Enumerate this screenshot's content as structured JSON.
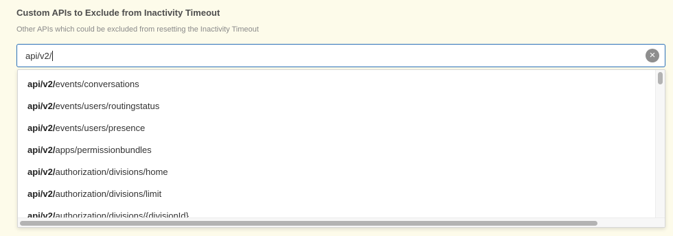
{
  "field": {
    "title": "Custom APIs to Exclude from Inactivity Timeout",
    "description": "Other APIs which could be excluded from resetting the Inactivity Timeout",
    "value": "api/v2/",
    "clear_glyph": "×"
  },
  "suggestions": [
    {
      "match": "api/v2/",
      "rest": "events/conversations"
    },
    {
      "match": "api/v2/",
      "rest": "events/users/routingstatus"
    },
    {
      "match": "api/v2/",
      "rest": "events/users/presence"
    },
    {
      "match": "api/v2/",
      "rest": "apps/permissionbundles"
    },
    {
      "match": "api/v2/",
      "rest": "authorization/divisions/home"
    },
    {
      "match": "api/v2/",
      "rest": "authorization/divisions/limit"
    },
    {
      "match": "api/v2/",
      "rest": "authorization/divisions/{divisionId}"
    }
  ],
  "colors": {
    "background": "#fdfbea",
    "focus_border": "#2a6fb5",
    "clear_button": "#8e8e8e"
  },
  "icons": {
    "clear": "clear-circle-icon"
  }
}
